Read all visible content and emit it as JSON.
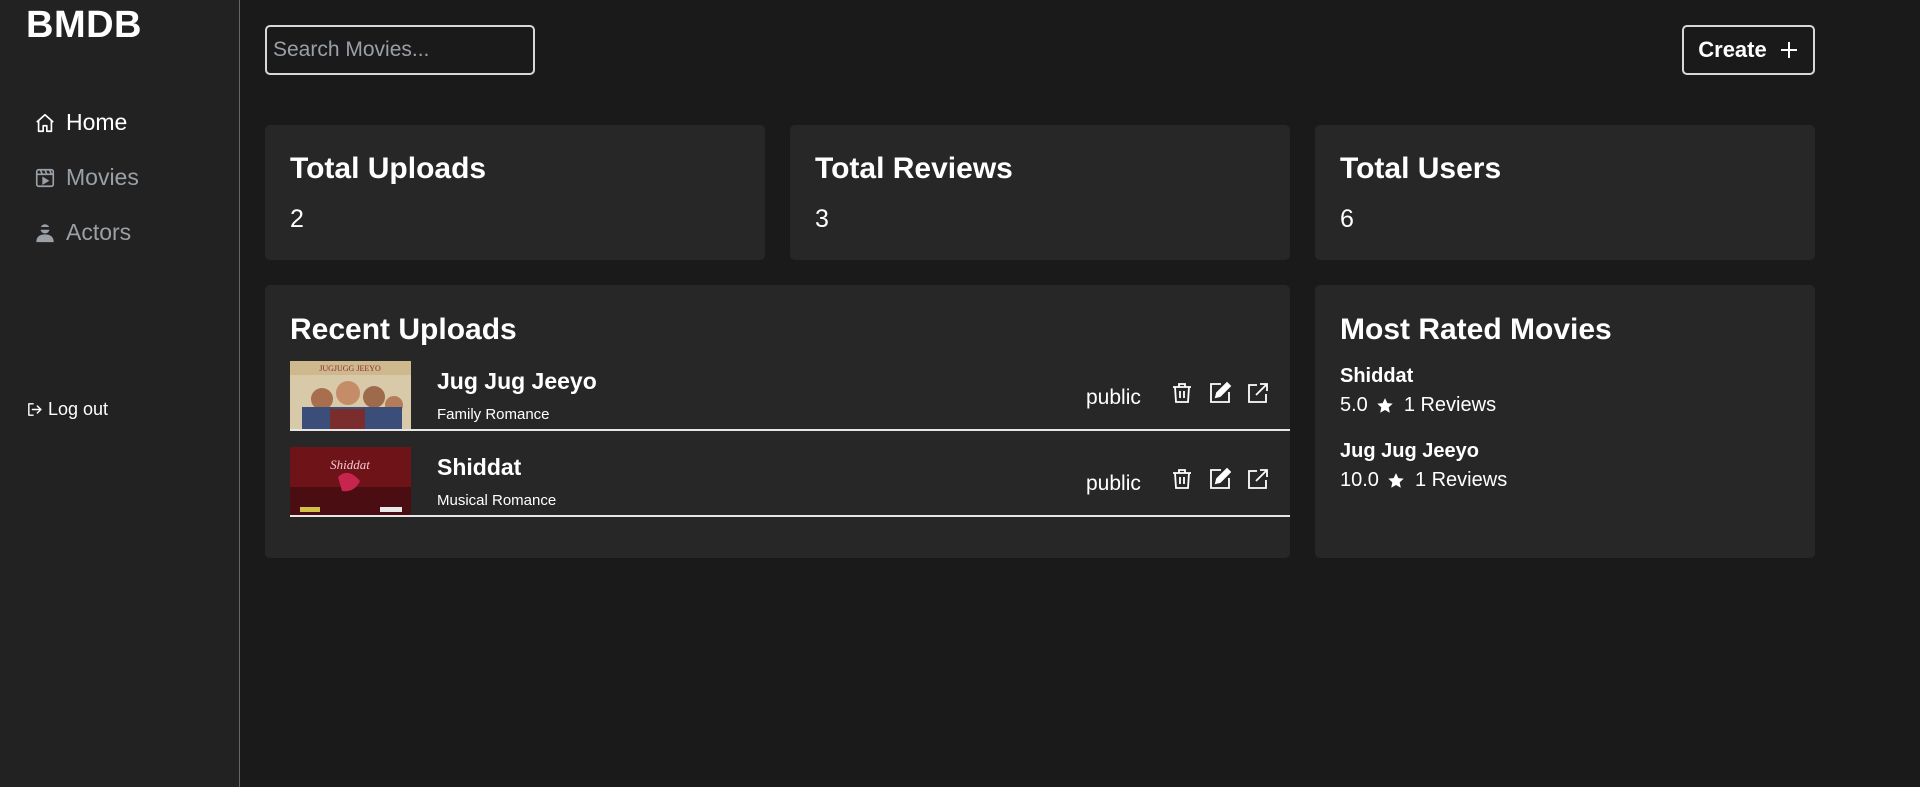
{
  "app": {
    "brand": "BMDB"
  },
  "sidebar": {
    "items": [
      {
        "label": "Home",
        "icon": "home-icon",
        "active": true
      },
      {
        "label": "Movies",
        "icon": "film-icon",
        "active": false
      },
      {
        "label": "Actors",
        "icon": "user-icon",
        "active": false
      }
    ],
    "logout_label": "Log out"
  },
  "header": {
    "search_placeholder": "Search Movies...",
    "create_label": "Create"
  },
  "stats": [
    {
      "title": "Total Uploads",
      "value": "2"
    },
    {
      "title": "Total Reviews",
      "value": "3"
    },
    {
      "title": "Total Users",
      "value": "6"
    }
  ],
  "recent_uploads": {
    "title": "Recent Uploads",
    "items": [
      {
        "title": "Jug Jug Jeeyo",
        "genres": "Family Romance",
        "status": "public",
        "poster_text": "JUGJUGG JEEYO"
      },
      {
        "title": "Shiddat",
        "genres": "Musical Romance",
        "status": "public",
        "poster_text": "Shiddat"
      }
    ]
  },
  "most_rated": {
    "title": "Most Rated Movies",
    "items": [
      {
        "name": "Shiddat",
        "rating": "5.0",
        "reviews": "1 Reviews"
      },
      {
        "name": "Jug Jug Jeeyo",
        "rating": "10.0",
        "reviews": "1 Reviews"
      }
    ]
  },
  "colors": {
    "background": "#1a1a1a",
    "sidebar": "#222222",
    "card": "#272727",
    "muted": "#9aa0a6"
  }
}
